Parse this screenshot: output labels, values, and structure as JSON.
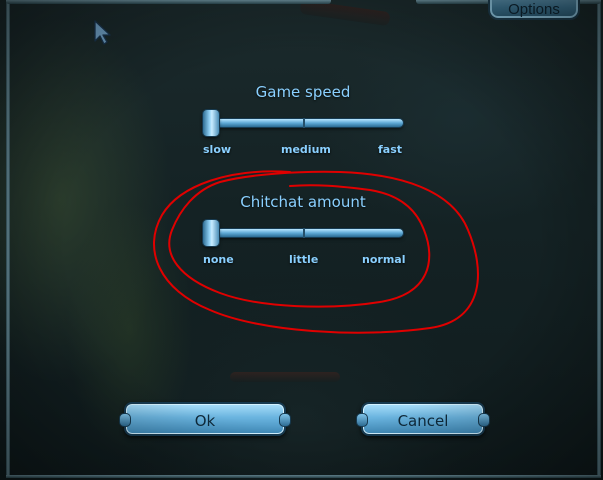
{
  "header": {
    "tab_label": "Options"
  },
  "game_speed": {
    "title": "Game speed",
    "ticks": [
      "slow",
      "medium",
      "fast"
    ],
    "selected": "slow"
  },
  "chitchat": {
    "title": "Chitchat amount",
    "ticks": [
      "none",
      "little",
      "normal"
    ],
    "selected": "none"
  },
  "buttons": {
    "ok": "Ok",
    "cancel": "Cancel"
  },
  "colors": {
    "label_text": "#8ad0ff",
    "button_fill": "#6ab4df",
    "annotation": "#e00000"
  }
}
